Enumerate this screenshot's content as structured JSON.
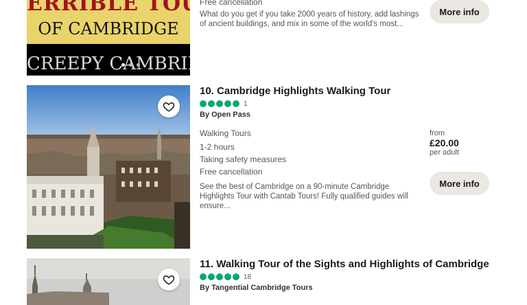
{
  "listings": [
    {
      "banner_top": "ERRIBLE TOUR",
      "banner_mid": "OF CAMBRIDGE",
      "banner_bottom": "CREEPY CAMBRIDGE",
      "cancellation": "Free cancellation",
      "description": "What do you get if you take 2000 years of history, add lashings of ancient buildings, and mix in some of the world's most...",
      "button": "More info"
    },
    {
      "title": "10. Cambridge Highlights Walking Tour",
      "rating_count": "1",
      "operator": "By Open Pass",
      "category": "Walking Tours",
      "duration": "1-2 hours",
      "safety": "Taking safety measures",
      "cancellation": "Free cancellation",
      "description": "See the best of Cambridge on a 90-minute Cambridge Highlights Tour with Cantab Tours! Fully qualified guides will ensure...",
      "price_from": "from",
      "price": "£20.00",
      "price_unit": "per adult",
      "button": "More info"
    },
    {
      "title": "11. Walking Tour of the Sights and Highlights of Cambridge",
      "rating_count": "18",
      "operator": "By Tangential Cambridge Tours"
    }
  ],
  "colors": {
    "rating": "#00aa6c",
    "button_bg": "#ebe8e2"
  }
}
